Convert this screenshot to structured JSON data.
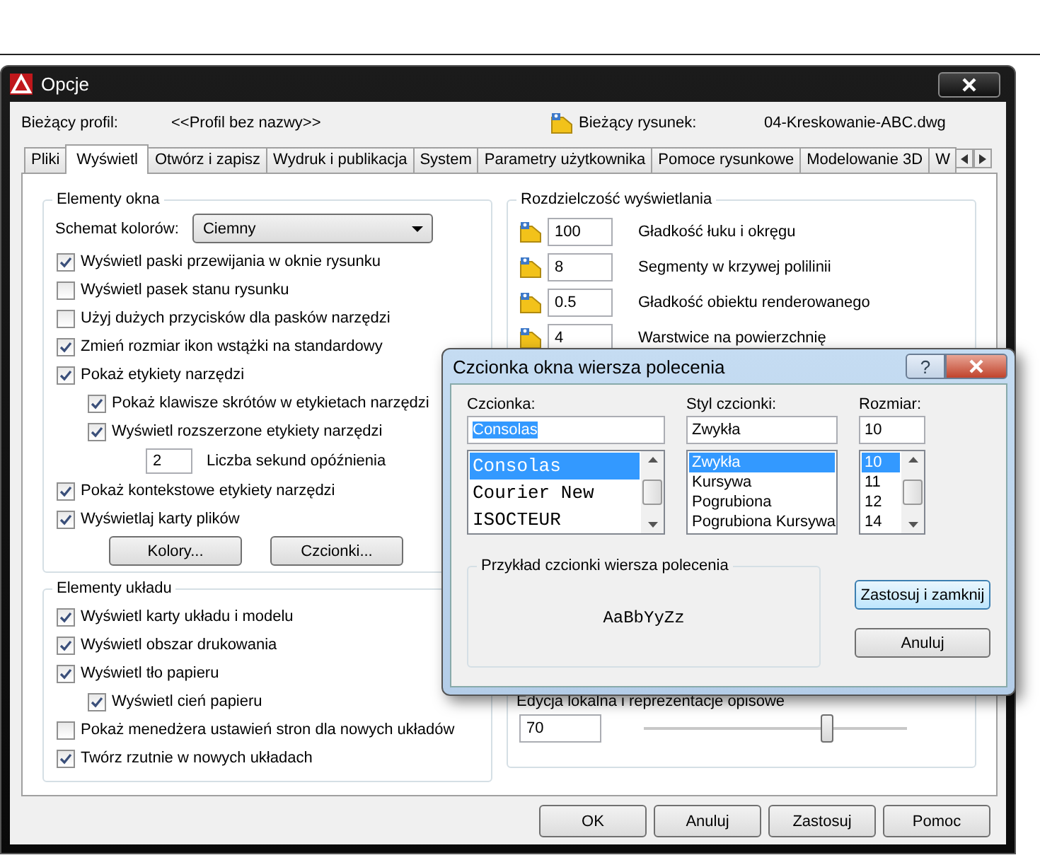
{
  "window": {
    "title": "Opcje"
  },
  "profile": {
    "label": "Bieżący profil:",
    "value": "<<Profil bez nazwy>>"
  },
  "drawing": {
    "label": "Bieżący rysunek:",
    "value": "04-Kreskowanie-ABC.dwg"
  },
  "tabs": [
    {
      "label": "Pliki",
      "selected": false
    },
    {
      "label": "Wyświetl",
      "selected": true
    },
    {
      "label": "Otwórz i zapisz",
      "selected": false
    },
    {
      "label": "Wydruk i publikacja",
      "selected": false
    },
    {
      "label": "System",
      "selected": false
    },
    {
      "label": "Parametry użytkownika",
      "selected": false
    },
    {
      "label": "Pomoce rysunkowe",
      "selected": false
    },
    {
      "label": "Modelowanie 3D",
      "selected": false
    },
    {
      "label": "W",
      "selected": false
    }
  ],
  "window_elements": {
    "title": "Elementy okna",
    "color_scheme": {
      "label": "Schemat kolorów:",
      "value": "Ciemny"
    },
    "items": [
      {
        "kind": "checkbox",
        "label": "Wyświetl paski przewijania w oknie rysunku",
        "checked": true
      },
      {
        "kind": "checkbox",
        "label": "Wyświetl pasek stanu rysunku",
        "checked": false
      },
      {
        "kind": "checkbox",
        "label": "Użyj dużych przycisków dla pasków narzędzi",
        "checked": false
      },
      {
        "kind": "checkbox",
        "label": "Zmień rozmiar ikon wstążki na standardowy",
        "checked": true
      },
      {
        "kind": "checkbox",
        "label": "Pokaż etykiety narzędzi",
        "checked": true,
        "children": [
          {
            "kind": "checkbox",
            "label": "Pokaż klawisze skrótów w etykietach narzędzi",
            "checked": true
          },
          {
            "kind": "checkbox",
            "label": "Wyświetl rozszerzone etykiety narzędzi",
            "checked": true,
            "children": [
              {
                "kind": "number",
                "value": "2",
                "label": "Liczba sekund opóźnienia"
              }
            ]
          }
        ]
      },
      {
        "kind": "checkbox",
        "label": "Pokaż kontekstowe etykiety narzędzi",
        "checked": true
      },
      {
        "kind": "checkbox",
        "label": "Wyświetlaj karty plików",
        "checked": true
      }
    ],
    "buttons": [
      "Kolory...",
      "Czcionki..."
    ]
  },
  "layout_elements": {
    "title": "Elementy układu",
    "items": [
      {
        "kind": "checkbox",
        "label": "Wyświetl karty układu i modelu",
        "checked": true
      },
      {
        "kind": "checkbox",
        "label": "Wyświetl obszar drukowania",
        "checked": true
      },
      {
        "kind": "checkbox",
        "label": "Wyświetl tło papieru",
        "checked": true,
        "children": [
          {
            "kind": "checkbox",
            "label": "Wyświetl cień papieru",
            "checked": true
          }
        ]
      },
      {
        "kind": "checkbox",
        "label": "Pokaż menedżera ustawień stron dla nowych układów",
        "checked": false
      },
      {
        "kind": "checkbox",
        "label": "Twórz rzutnie w nowych układach",
        "checked": true
      }
    ]
  },
  "display_resolution": {
    "title": "Rozdzielczość wyświetlania",
    "rows": [
      {
        "value": "100",
        "label": "Gładkość łuku i okręgu"
      },
      {
        "value": "8",
        "label": "Segmenty w krzywej polilinii"
      },
      {
        "value": "0.5",
        "label": "Gładkość obiektu renderowanego"
      },
      {
        "value": "4",
        "label": "Warstwice na powierzchnię"
      }
    ]
  },
  "in_place_edit": {
    "label": "Edycja lokalna i reprezentacje opisowe",
    "value": "70",
    "level": 0.7
  },
  "footer_buttons": [
    "OK",
    "Anuluj",
    "Zastosuj",
    "Pomoc"
  ],
  "font_dialog": {
    "title": "Czcionka okna wiersza polecenia",
    "help": "?",
    "font": {
      "label": "Czcionka:",
      "value": "Consolas",
      "options": [
        {
          "label": "Consolas",
          "selected": true
        },
        {
          "label": "Courier New",
          "selected": false
        },
        {
          "label": "ISOCTEUR",
          "selected": false
        }
      ]
    },
    "style": {
      "label": "Styl czcionki:",
      "value": "Zwykła",
      "options": [
        {
          "label": "Zwykła",
          "selected": true
        },
        {
          "label": "Kursywa",
          "selected": false
        },
        {
          "label": "Pogrubiona",
          "selected": false
        },
        {
          "label": "Pogrubiona Kursywa",
          "selected": false
        }
      ]
    },
    "size": {
      "label": "Rozmiar:",
      "value": "10",
      "options": [
        {
          "label": "10",
          "selected": true
        },
        {
          "label": "11",
          "selected": false
        },
        {
          "label": "12",
          "selected": false
        },
        {
          "label": "14",
          "selected": false
        }
      ]
    },
    "sample": {
      "title": "Przykład czcionki wiersza polecenia",
      "text": "AaBbYyZz"
    },
    "buttons": [
      {
        "label": "Zastosuj i zamknij",
        "default": true
      },
      {
        "label": "Anuluj",
        "default": false
      }
    ]
  }
}
